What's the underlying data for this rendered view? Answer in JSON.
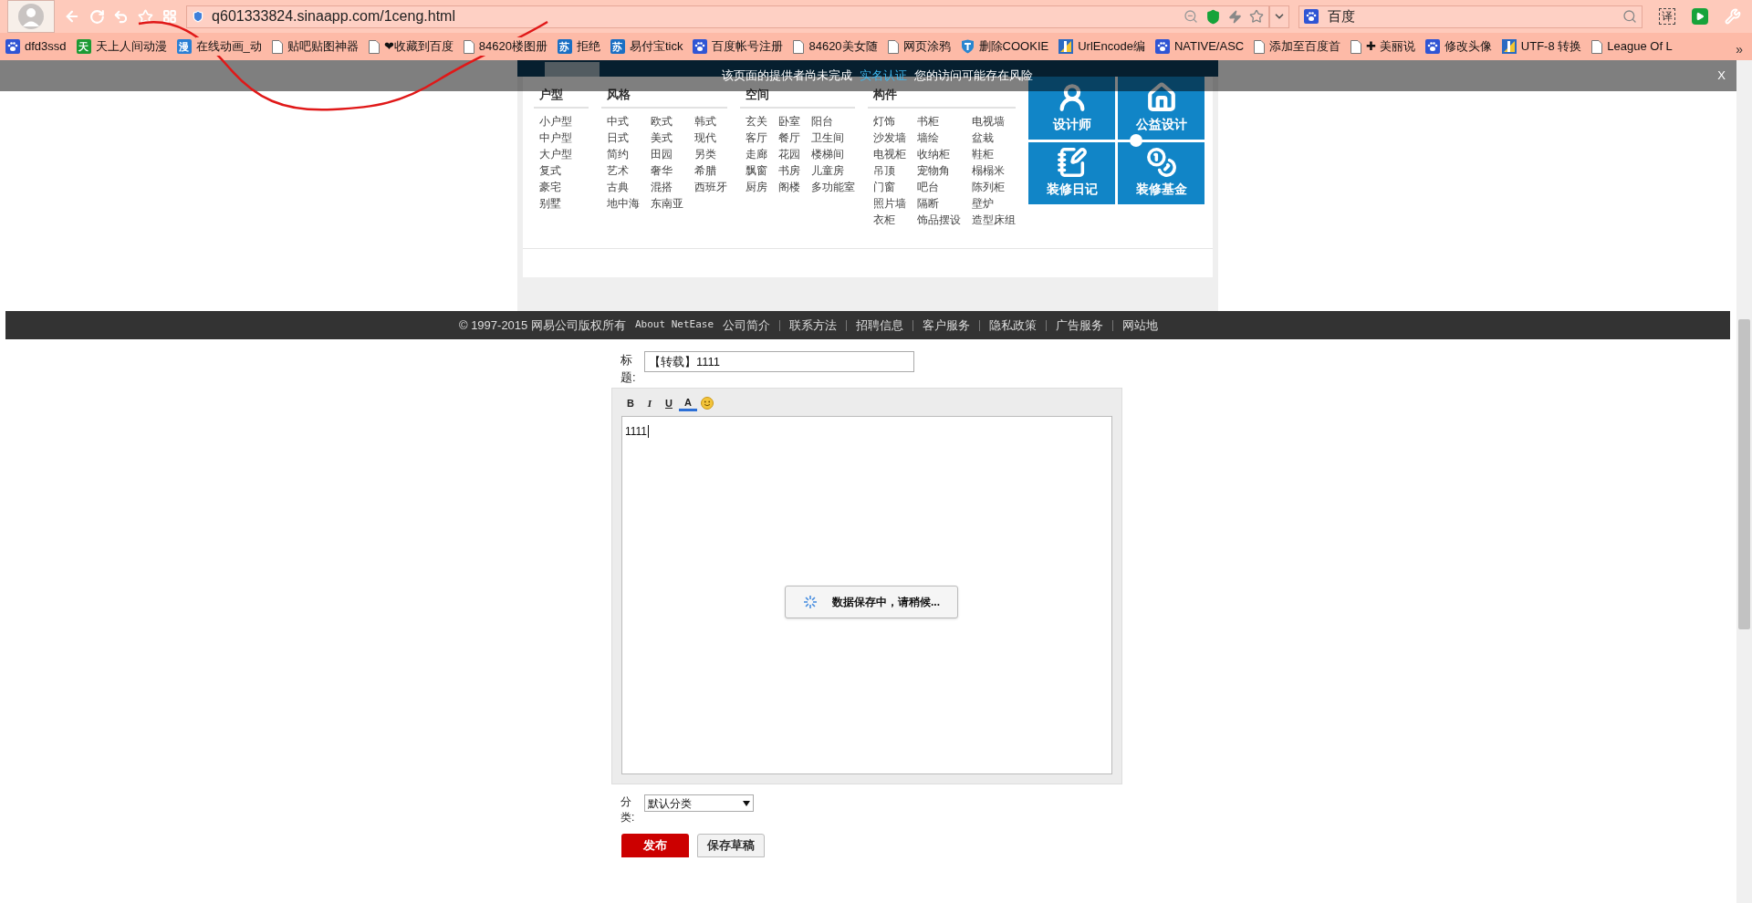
{
  "browser": {
    "url": "q601333824.sinaapp.com/1ceng.html",
    "search": "百度",
    "translate_glyph": "译",
    "more": "»",
    "bookmarks": [
      {
        "label": "dfd3ssd",
        "kind": "paw"
      },
      {
        "label": "天上人间动漫",
        "kind": "badge",
        "glyph": "天",
        "color": "#1c9a34"
      },
      {
        "label": "在线动画_动",
        "kind": "badge",
        "glyph": "漫",
        "color": "#2a7fd4"
      },
      {
        "label": "贴吧贴图神器",
        "kind": "page"
      },
      {
        "label": "❤收藏到百度",
        "kind": "page"
      },
      {
        "label": "84620楼图册",
        "kind": "page"
      },
      {
        "label": "拒绝",
        "kind": "badge",
        "glyph": "苏",
        "color": "#1a6fc4"
      },
      {
        "label": "易付宝tick",
        "kind": "badge",
        "glyph": "苏",
        "color": "#1a6fc4"
      },
      {
        "label": "百度帐号注册",
        "kind": "paw"
      },
      {
        "label": "84620美女随",
        "kind": "page"
      },
      {
        "label": "网页涂鸦",
        "kind": "page"
      },
      {
        "label": "删除COOKIE",
        "kind": "shield"
      },
      {
        "label": "UrlEncode编",
        "kind": "flag"
      },
      {
        "label": "NATIVE/ASC",
        "kind": "paw"
      },
      {
        "label": "添加至百度首",
        "kind": "page"
      },
      {
        "label": "✚ 美丽说",
        "kind": "page"
      },
      {
        "label": "修改头像",
        "kind": "paw"
      },
      {
        "label": "UTF-8 转换",
        "kind": "flag"
      },
      {
        "label": "League Of L",
        "kind": "page"
      }
    ]
  },
  "security_banner": {
    "text": "该页面的提供者尚未完成",
    "link": "实名认证",
    "warning": "您的访问可能存在风险",
    "close": "X"
  },
  "site_menu": {
    "columns": [
      {
        "heading": "户型",
        "items": [
          "小户型",
          "中户型",
          "大户型",
          "复式",
          "豪宅",
          "别墅"
        ]
      },
      {
        "heading": "风格",
        "items": [
          "中式",
          "欧式",
          "韩式",
          "日式",
          "美式",
          "现代",
          "简约",
          "田园",
          "另类",
          "艺术",
          "奢华",
          "希腊",
          "古典",
          "混搭",
          "西班牙",
          "地中海",
          "东南亚"
        ]
      },
      {
        "heading": "空间",
        "items": [
          "玄关",
          "卧室",
          "阳台",
          "客厅",
          "餐厅",
          "卫生间",
          "走廊",
          "花园",
          "楼梯间",
          "飘窗",
          "书房",
          "儿童房",
          "厨房",
          "阁楼",
          "多功能室"
        ]
      },
      {
        "heading": "构件",
        "items": [
          "灯饰",
          "书柜",
          "电视墙",
          "沙发墙",
          "墙绘",
          "盆栽",
          "电视柜",
          "收纳柜",
          "鞋柜",
          "吊顶",
          "宠物角",
          "榻榻米",
          "门窗",
          "吧台",
          "陈列柜",
          "照片墙",
          "隔断",
          "壁炉",
          "衣柜",
          "饰品摆设",
          "造型床组"
        ]
      }
    ],
    "tiles": [
      {
        "label": "设计师",
        "kind": "person"
      },
      {
        "label": "公益设计",
        "kind": "house"
      },
      {
        "label": "装修日记",
        "kind": "notebook"
      },
      {
        "label": "装修基金",
        "kind": "coins"
      }
    ]
  },
  "footer": {
    "copyright": "© 1997-2015 网易公司版权所有",
    "links": [
      "About NetEase",
      "公司简介",
      "联系方法",
      "招聘信息",
      "客户服务",
      "隐私政策",
      "广告服务",
      "网站地"
    ]
  },
  "form": {
    "title_label": "标题:",
    "title_value": "【转载】1111",
    "toolbar": [
      {
        "kind": "bold",
        "label": "B"
      },
      {
        "kind": "italic",
        "label": "I"
      },
      {
        "kind": "underline",
        "label": "U"
      },
      {
        "kind": "color",
        "label": "A"
      },
      {
        "kind": "emoji"
      }
    ],
    "body": "1111",
    "loading": "数据保存中，请稍候...",
    "category_label": "分类:",
    "category_value": "默认分类",
    "buttons": [
      {
        "kind": "primary",
        "label": "发布"
      },
      {
        "kind": "secondary",
        "label": "保存草稿"
      }
    ]
  }
}
